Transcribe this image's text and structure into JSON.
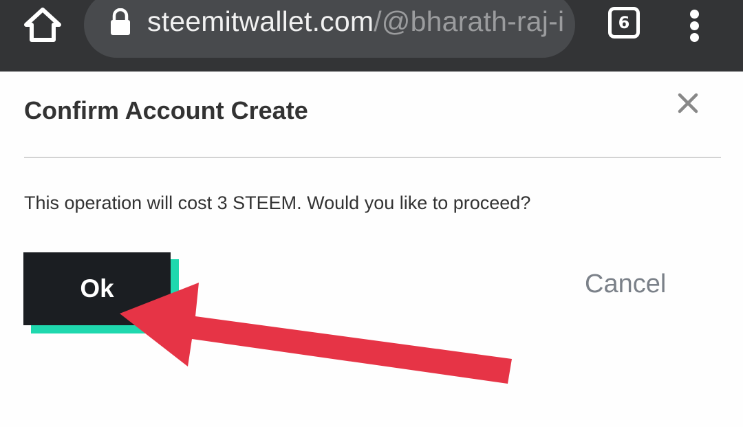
{
  "browser": {
    "url_host": "steemitwallet.com",
    "url_path": "/@bharath-raj-i",
    "tab_count": "6",
    "icons": {
      "home": "home-icon",
      "lock": "lock-icon",
      "tabs": "tab-switcher-icon",
      "menu": "more-vert-icon"
    }
  },
  "modal": {
    "title": "Confirm Account Create",
    "message": "This operation will cost 3 STEEM. Would you like to proceed?",
    "ok_label": "Ok",
    "cancel_label": "Cancel",
    "close_icon": "close-icon"
  },
  "annotation": {
    "icon": "arrow-icon",
    "color": "#e63446"
  },
  "colors": {
    "toolbar_bg": "#333436",
    "ok_bg": "#1b1e22",
    "ok_shadow": "#1fd8ae"
  }
}
